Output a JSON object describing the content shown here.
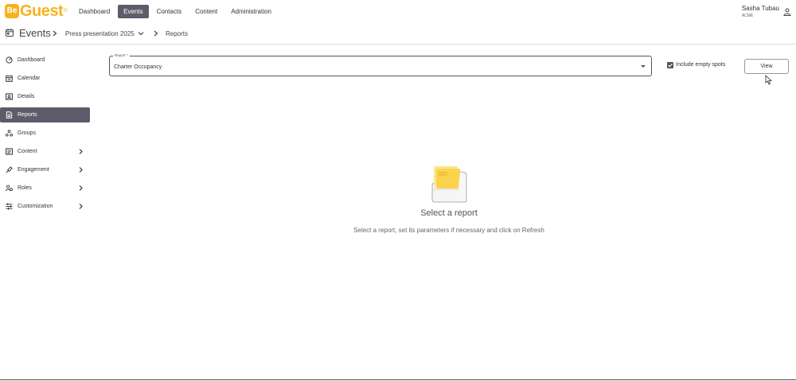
{
  "brand": {
    "badge": "Be",
    "name": "Guest",
    "reg": "®",
    "color": "#f6b321"
  },
  "nav": {
    "items": [
      {
        "label": "Dashboard",
        "active": false
      },
      {
        "label": "Events",
        "active": true
      },
      {
        "label": "Contacts",
        "active": false
      },
      {
        "label": "Content",
        "active": false
      },
      {
        "label": "Administration",
        "active": false
      }
    ],
    "active_color": "#5d5c6b"
  },
  "user": {
    "name": "Sasha Tubau",
    "org": "ACME",
    "icon": "person-icon"
  },
  "breadcrumb": {
    "root": "Events",
    "root_icon": "calendar-icon",
    "event": "Press presentation 2025",
    "page": "Reports"
  },
  "sidebar": {
    "items": [
      {
        "label": "Dashboard",
        "icon": "dashboard-icon",
        "chevron": false,
        "active": false
      },
      {
        "label": "Calendar",
        "icon": "calendar-icon",
        "chevron": false,
        "active": false
      },
      {
        "label": "Details",
        "icon": "details-icon",
        "chevron": false,
        "active": false
      },
      {
        "label": "Reports",
        "icon": "reports-icon",
        "chevron": false,
        "active": true
      },
      {
        "label": "Groups",
        "icon": "groups-icon",
        "chevron": false,
        "active": false
      },
      {
        "label": "Content",
        "icon": "content-icon",
        "chevron": true,
        "active": false
      },
      {
        "label": "Engagement",
        "icon": "engagement-icon",
        "chevron": true,
        "active": false
      },
      {
        "label": "Roles",
        "icon": "roles-icon",
        "chevron": true,
        "active": false
      },
      {
        "label": "Customization",
        "icon": "customization-icon",
        "chevron": true,
        "active": false
      }
    ]
  },
  "report": {
    "label": "Report *",
    "value": "Charter Occupancy",
    "include_empty_label": "Include empty spots",
    "include_empty_checked": true,
    "view_label": "View"
  },
  "empty_state": {
    "title": "Select a report",
    "text": "Select a report, set its parameters if necessary and click on Refresh",
    "icon": "folder-icon"
  }
}
